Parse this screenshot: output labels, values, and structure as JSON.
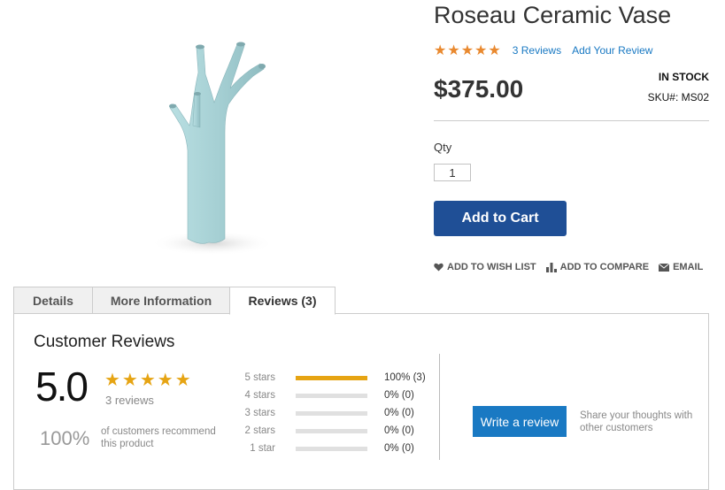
{
  "product": {
    "title": "Roseau Ceramic Vase",
    "stars": "★★★★★",
    "reviews_link": "3 Reviews",
    "add_review_link": "Add Your Review",
    "price": "$375.00",
    "stock": "IN STOCK",
    "sku": "SKU#: MS02",
    "qty_label": "Qty",
    "qty_value": "1",
    "add_to_cart": "Add to Cart",
    "image_name": "ceramic-vase-image",
    "vase_color": "#a9d3d7"
  },
  "actions": [
    {
      "label": "ADD TO WISH LIST",
      "icon": "heart-icon"
    },
    {
      "label": "ADD TO COMPARE",
      "icon": "bar-chart-icon"
    },
    {
      "label": "EMAIL",
      "icon": "envelope-icon"
    }
  ],
  "tabs": {
    "details": "Details",
    "more_info": "More Information",
    "reviews": "Reviews (3)",
    "active": "reviews"
  },
  "reviews": {
    "heading": "Customer Reviews",
    "average": "5.0",
    "stars": "★★★★★",
    "count": "3 reviews",
    "recommend_pct": "100%",
    "recommend_text": "of customers recommend this product",
    "breakdown": [
      {
        "label": "5 stars",
        "fraction": 1.0,
        "value": "100% (3)"
      },
      {
        "label": "4 stars",
        "fraction": 0.0,
        "value": "0% (0)"
      },
      {
        "label": "3 stars",
        "fraction": 0.0,
        "value": "0% (0)"
      },
      {
        "label": "2 stars",
        "fraction": 0.0,
        "value": "0% (0)"
      },
      {
        "label": "1 star",
        "fraction": 0.0,
        "value": "0% (0)"
      }
    ],
    "write_button": "Write a review",
    "share_text": "Share your thoughts with other customers"
  },
  "colors": {
    "accent_blue": "#1979c3",
    "cart_blue": "#1f4f96",
    "star_orange": "#e9892f",
    "star_gold": "#e6a413"
  }
}
